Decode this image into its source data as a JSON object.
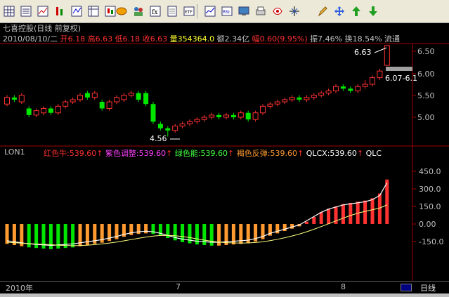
{
  "toolbar": {
    "icons": [
      "grid-icon",
      "list-icon",
      "trend-icon",
      "bar-chart-icon",
      "compare-icon",
      "table-icon",
      "candle-icon",
      "coin-icon",
      "people-icon",
      "fx-icon",
      "doc-icon",
      "etf-icon",
      "kline-icon",
      "rsi-icon",
      "screen-icon",
      "print-icon",
      "info-icon",
      "zoom-icon",
      "pen-icon",
      "move-icon",
      "arrow-up-icon",
      "arrow-down-icon"
    ]
  },
  "header": {
    "title": "七喜控股(日线 前复权)",
    "date": "2010/08/10/二",
    "open_label": "开",
    "open": "6.18",
    "high_label": "高",
    "high": "6.63",
    "low_label": "低",
    "low": "6.18",
    "close_label": "收",
    "close": "6.63",
    "vol_label": "量",
    "vol": "354364.0",
    "amt_label": "额",
    "amt": "2.34亿",
    "chg_label": "幅",
    "chg": "0.60(9.95%)",
    "amp_label": "振",
    "amp": "7.46%",
    "turn_label": "换",
    "turn": "18.54%",
    "flow": "流通"
  },
  "price_panel": {
    "y_ticks": [
      "6.50",
      "6.00",
      "5.50",
      "5.00"
    ],
    "high_marker": "6.63",
    "low_marker": "4.56",
    "last_label": "6.07-6.1"
  },
  "indicator_panel": {
    "name": "LON1",
    "legends": [
      {
        "label": "红色牛:539.60",
        "color": "#ff3030"
      },
      {
        "label": "紫色调整:539.60",
        "color": "#ff40ff"
      },
      {
        "label": "绿色能:539.60",
        "color": "#40ff40"
      },
      {
        "label": "褐色反弹:539.60",
        "color": "#ff9a30"
      },
      {
        "label": "QLCX:539.60",
        "color": "#ffffff"
      },
      {
        "label": "QLC",
        "color": "#ffffff"
      }
    ],
    "y_ticks": [
      "450.0",
      "300.0",
      "150.0",
      "0.00",
      "-150.0"
    ]
  },
  "time_axis": {
    "labels": [
      "2010年",
      "7",
      "8"
    ],
    "period": "日线"
  },
  "colors": {
    "up": "#ff3232",
    "down": "#00e600",
    "orange": "#ff9a30",
    "axis": "#c0c0c0"
  }
}
